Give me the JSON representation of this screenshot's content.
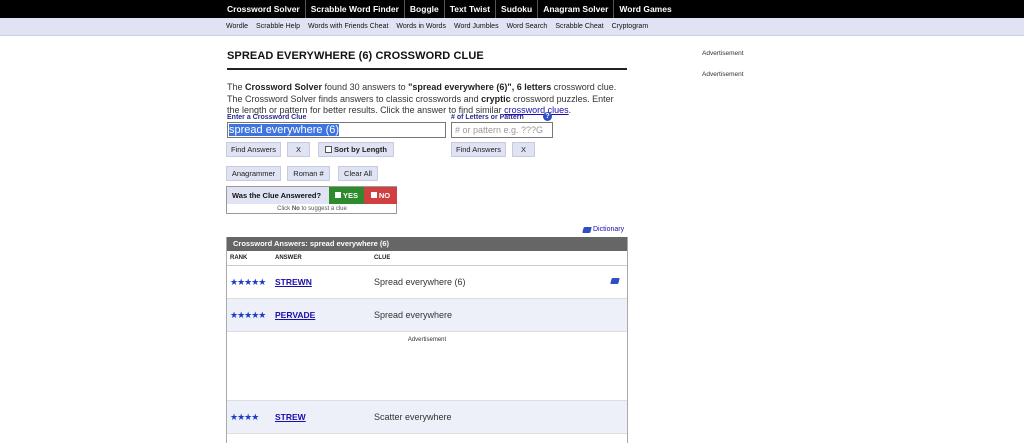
{
  "topnav": [
    "Crossword Solver",
    "Scrabble Word Finder",
    "Boggle",
    "Text Twist",
    "Sudoku",
    "Anagram Solver",
    "Word Games"
  ],
  "subnav": [
    "Wordle",
    "Scrabble Help",
    "Words with Friends Cheat",
    "Words in Words",
    "Word Jumbles",
    "Word Search",
    "Scrabble Cheat",
    "Cryptogram"
  ],
  "page": {
    "title": "SPREAD EVERYWHERE (6) CROSSWORD CLUE",
    "intro": {
      "p1": "The ",
      "b1": "Crossword Solver",
      "p2": " found 30 answers to ",
      "b2": "\"spread everywhere (6)\", 6 letters",
      "p3": " crossword clue. The Crossword Solver finds answers to classic crosswords and ",
      "b3": "cryptic",
      "p4": " crossword puzzles. Enter the length or pattern for better results. Click the answer to find similar ",
      "link": "crossword clues",
      "p5": "."
    }
  },
  "search": {
    "clue_label": "Enter a Crossword Clue",
    "clue_value": "spread everywhere  (6)",
    "pattern_label": "# of Letters or Pattern",
    "pattern_placeholder": "# or pattern e.g. ???G",
    "help": "?",
    "find_answers": "Find Answers",
    "clear_x": "X",
    "sort_by_length": "Sort by Length",
    "find_answers_2": "Find Answers",
    "clear_x_2": "X",
    "anagrammer": "Anagrammer",
    "roman": "Roman #",
    "clear_all": "Clear All"
  },
  "answered": {
    "question": "Was the Clue Answered?",
    "yes": "YES",
    "no": "NO",
    "hint_pre": "Click ",
    "hint_bold": "No",
    "hint_post": " to suggest a clue"
  },
  "dictionary": "Dictionary",
  "results": {
    "header": "Crossword Answers: spread everywhere (6)",
    "col_rank": "RANK",
    "col_answer": "ANSWER",
    "col_clue": "CLUE",
    "rows": [
      {
        "stars": "★★★★★",
        "rating": 5,
        "answer": "STREWN",
        "clue": "Spread everywhere (6)"
      },
      {
        "stars": "★★★★★",
        "rating": 5,
        "answer": "PERVADE",
        "clue": "Spread everywhere"
      },
      {
        "stars": "★★★★",
        "rating": 4,
        "answer": "STREW",
        "clue": "Scatter everywhere"
      }
    ],
    "ad_label": "Advertisement"
  },
  "side": {
    "ad1": "Advertisement",
    "ad2": "Advertisement"
  },
  "colors": {
    "accent": "#2e4fc4",
    "yes": "#2d8a2d",
    "no": "#d04040",
    "nav_bg": "#000000",
    "subnav_bg": "#dfe3f3"
  }
}
